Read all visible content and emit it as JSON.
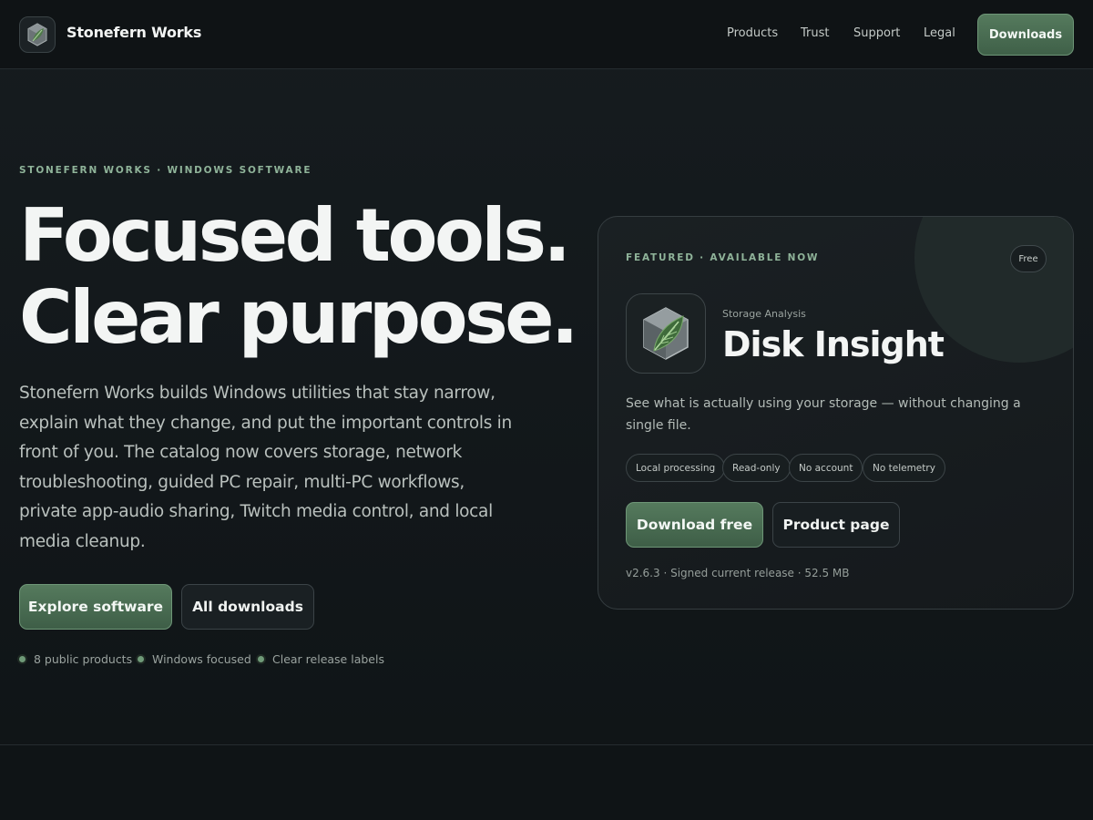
{
  "nav": {
    "brand_name": "Stonefern Works",
    "links": [
      "Products",
      "Trust",
      "Support",
      "Legal"
    ],
    "cta_label": "Downloads"
  },
  "hero": {
    "eyebrow": "STONEFERN WORKS · WINDOWS SOFTWARE",
    "title_line1": "Focused tools.",
    "title_line2": "Clear purpose.",
    "description": "Stonefern Works builds Windows utilities that stay narrow, explain what they change, and put the important controls in front of you. The catalog now covers storage, network troubleshooting, guided PC repair, multi-PC workflows, private app-audio sharing, Twitch media control, and local media cleanup.",
    "primary_button": "Explore software",
    "secondary_button": "All downloads",
    "stats": [
      "8 public products",
      "Windows focused",
      "Clear release labels"
    ]
  },
  "featured": {
    "eyebrow": "FEATURED · AVAILABLE NOW",
    "badge": "Free",
    "category": "Storage Analysis",
    "name": "Disk Insight",
    "description": "See what is actually using your storage — without changing a single file.",
    "tags": [
      "Local processing",
      "Read-only",
      "No account",
      "No telemetry"
    ],
    "primary_button": "Download free",
    "secondary_button": "Product page",
    "meta": "v2.6.3 · Signed current release · 52.5 MB",
    "icon": "fern-leaf-hexagon-icon"
  },
  "colors": {
    "accent_green": "#557a5d",
    "eyebrow_green": "#8fb399",
    "background": "#12171a"
  }
}
